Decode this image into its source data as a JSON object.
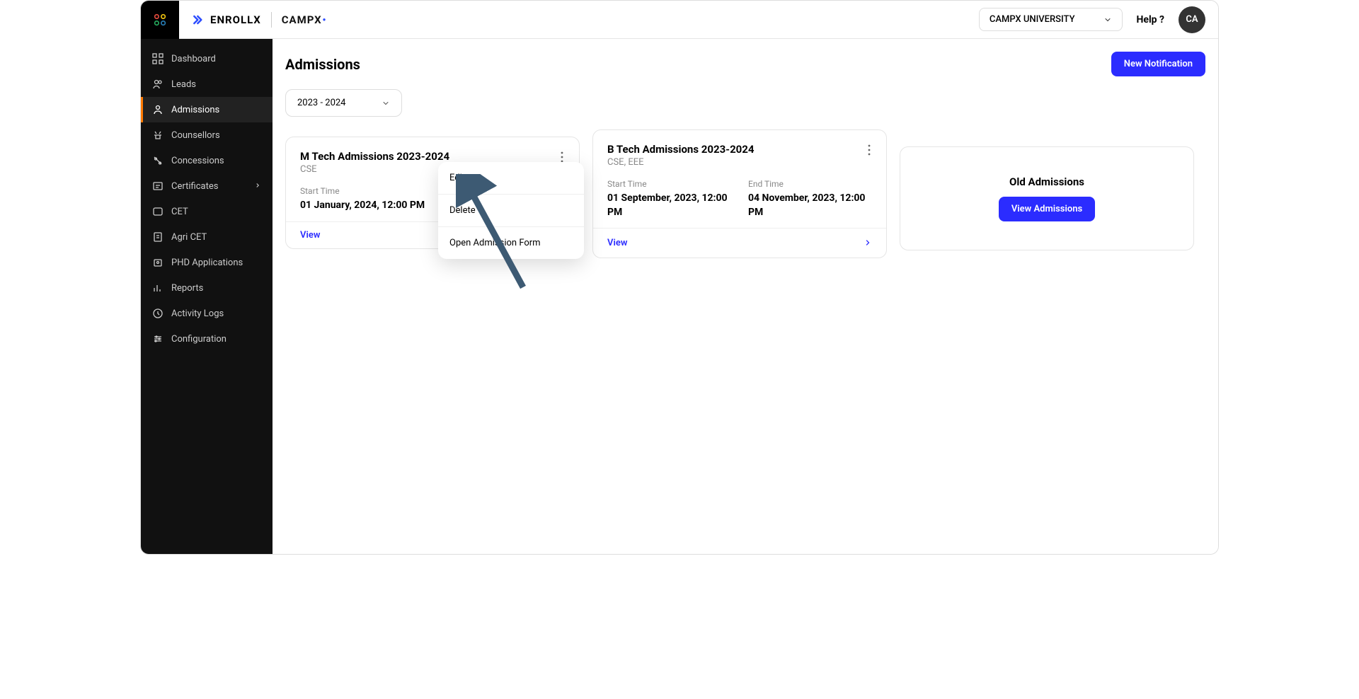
{
  "brand": {
    "enrollx": "ENROLLX",
    "campx": "CAMPX"
  },
  "topbar": {
    "university": "CAMPX UNIVERSITY",
    "help": "Help ?",
    "avatar_initials": "CA"
  },
  "sidebar": {
    "items": [
      {
        "label": "Dashboard"
      },
      {
        "label": "Leads"
      },
      {
        "label": "Admissions"
      },
      {
        "label": "Counsellors"
      },
      {
        "label": "Concessions"
      },
      {
        "label": "Certificates"
      },
      {
        "label": "CET"
      },
      {
        "label": "Agri CET"
      },
      {
        "label": "PHD Applications"
      },
      {
        "label": "Reports"
      },
      {
        "label": "Activity Logs"
      },
      {
        "label": "Configuration"
      }
    ]
  },
  "page": {
    "title": "Admissions",
    "new_notification_btn": "New Notification",
    "year": "2023 - 2024"
  },
  "cards": [
    {
      "title": "M Tech Admissions 2023-2024",
      "subtitle": "CSE",
      "start_label": "Start Time",
      "start_value": "01 January, 2024, 12:00 PM",
      "end_label": "",
      "end_value": "",
      "view": "View"
    },
    {
      "title": "B Tech Admissions 2023-2024",
      "subtitle": "CSE, EEE",
      "start_label": "Start Time",
      "start_value": "01 September, 2023, 12:00 PM",
      "end_label": "End Time",
      "end_value": "04 November, 2023, 12:00 PM",
      "view": "View"
    }
  ],
  "old": {
    "title": "Old Admissions",
    "btn": "View Admissions"
  },
  "menu": {
    "edit": "Edit",
    "delete": "Delete",
    "open_form": "Open Admission Form"
  }
}
